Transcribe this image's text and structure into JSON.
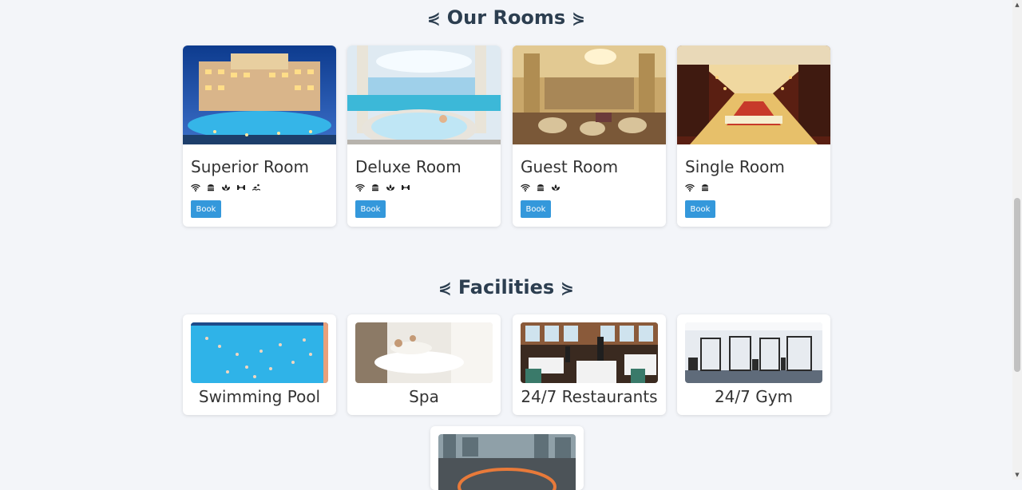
{
  "rooms_section": {
    "title": "Our Rooms",
    "deco_left": "⋞",
    "deco_right": "⋟"
  },
  "rooms": [
    {
      "name": "Superior Room",
      "amenities": [
        "wifi-icon",
        "burger-icon",
        "lotus-icon",
        "dumbbell-icon",
        "swimmer-icon"
      ],
      "book_label": "Book"
    },
    {
      "name": "Deluxe Room",
      "amenities": [
        "wifi-icon",
        "burger-icon",
        "lotus-icon",
        "dumbbell-icon"
      ],
      "book_label": "Book"
    },
    {
      "name": "Guest Room",
      "amenities": [
        "wifi-icon",
        "burger-icon",
        "lotus-icon"
      ],
      "book_label": "Book"
    },
    {
      "name": "Single Room",
      "amenities": [
        "wifi-icon",
        "burger-icon"
      ],
      "book_label": "Book"
    }
  ],
  "facilities_section": {
    "title": "Facilities",
    "deco_left": "⋞",
    "deco_right": "⋟"
  },
  "facilities": [
    {
      "name": "Swimming Pool"
    },
    {
      "name": "Spa"
    },
    {
      "name": "24/7 Restaurants"
    },
    {
      "name": "24/7 Gym"
    },
    {
      "name": ""
    }
  ],
  "colors": {
    "accent": "#3498db",
    "heading": "#2c3e50",
    "background": "#f3f5f9"
  }
}
